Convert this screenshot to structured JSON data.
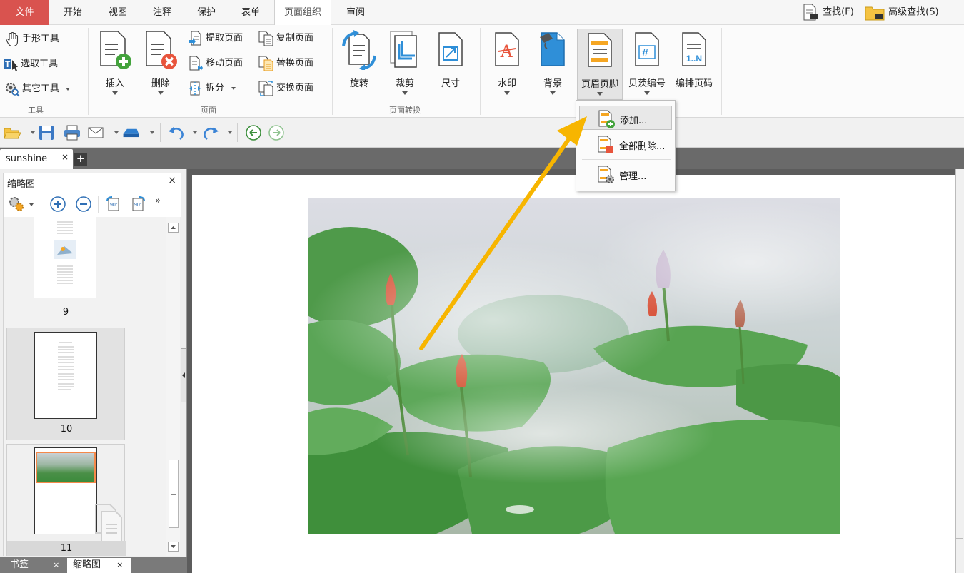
{
  "menubar": {
    "tabs": [
      "文件",
      "开始",
      "视图",
      "注释",
      "保护",
      "表单",
      "页面组织",
      "审阅"
    ],
    "active_tab": "页面组织",
    "find_label": "查找(F)",
    "advanced_find_label": "高级查找(S)"
  },
  "ribbon": {
    "tools_group": {
      "label": "工具",
      "items": [
        "手形工具",
        "选取工具",
        "其它工具"
      ]
    },
    "pages_group": {
      "label": "页面",
      "insert_label": "插入",
      "delete_label": "删除",
      "extract_label": "提取页面",
      "copy_label": "复制页面",
      "move_label": "移动页面",
      "replace_label": "替换页面",
      "split_label": "拆分",
      "swap_label": "交换页面"
    },
    "transform_group": {
      "label": "页面转换",
      "rotate_label": "旋转",
      "crop_label": "裁剪",
      "size_label": "尺寸"
    },
    "marks_group": {
      "watermark_label": "水印",
      "background_label": "背景",
      "header_footer_label": "页眉页脚",
      "bates_label": "贝茨编号",
      "page_number_label": "编排页码"
    }
  },
  "header_footer_menu": {
    "items": [
      "添加...",
      "全部删除...",
      "管理..."
    ],
    "highlighted": "添加..."
  },
  "document_tabs": {
    "active": "sunshine",
    "close_glyph": "×",
    "new_glyph": "+"
  },
  "left_panel": {
    "title": "缩略图",
    "close_glyph": "×",
    "thumbnails": [
      {
        "page": "9"
      },
      {
        "page": "10"
      },
      {
        "page": "11"
      }
    ],
    "bottom_tabs": [
      "书签",
      "缩略图"
    ]
  },
  "colors": {
    "file_tab": "#d9534f",
    "accent_orange": "#f5a623",
    "arrow": "#f7b500"
  }
}
